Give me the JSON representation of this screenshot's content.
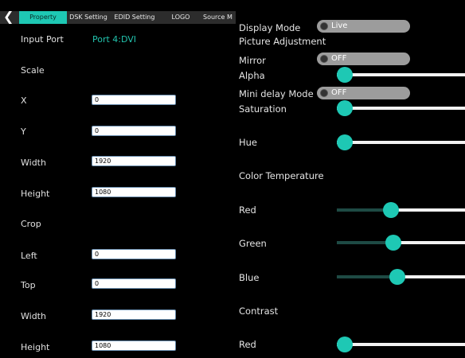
{
  "tabs": [
    {
      "label": "Property",
      "active": true
    },
    {
      "label": "DSK Setting",
      "active": false
    },
    {
      "label": "EDID Setting",
      "active": false
    },
    {
      "label": "LOGO",
      "active": false
    },
    {
      "label": "Source M",
      "active": false
    }
  ],
  "left": {
    "input_port_label": "Input Port",
    "input_port_value": "Port 4:DVI",
    "scale_label": "Scale",
    "x_label": "X",
    "x_value": "0",
    "y_label": "Y",
    "y_value": "0",
    "width_label": "Width",
    "width_value": "1920",
    "height_label": "Height",
    "height_value": "1080",
    "crop_label": "Crop",
    "left_label": "Left",
    "left_value": "0",
    "top_label": "Top",
    "top_value": "0",
    "crop_width_label": "Width",
    "crop_width_value": "1920",
    "crop_height_label": "Height",
    "crop_height_value": "1080"
  },
  "right": {
    "display_mode_label": "Display Mode",
    "display_mode_value": "Live",
    "picture_adjustment_label": "Picture Adjustment",
    "mirror_label": "Mirror",
    "mirror_value": "OFF",
    "alpha_label": "Alpha",
    "mini_delay_label": "Mini delay Mode",
    "mini_delay_value": "OFF",
    "saturation_label": "Saturation",
    "hue_label": "Hue",
    "color_temp_label": "Color Temperature",
    "red_label": "Red",
    "green_label": "Green",
    "blue_label": "Blue",
    "contrast_label": "Contrast",
    "contrast_red_label": "Red"
  },
  "colors": {
    "accent": "#1ec8b4",
    "toggle": "#9c9c9c",
    "tab_bar": "#2c2c2c"
  }
}
